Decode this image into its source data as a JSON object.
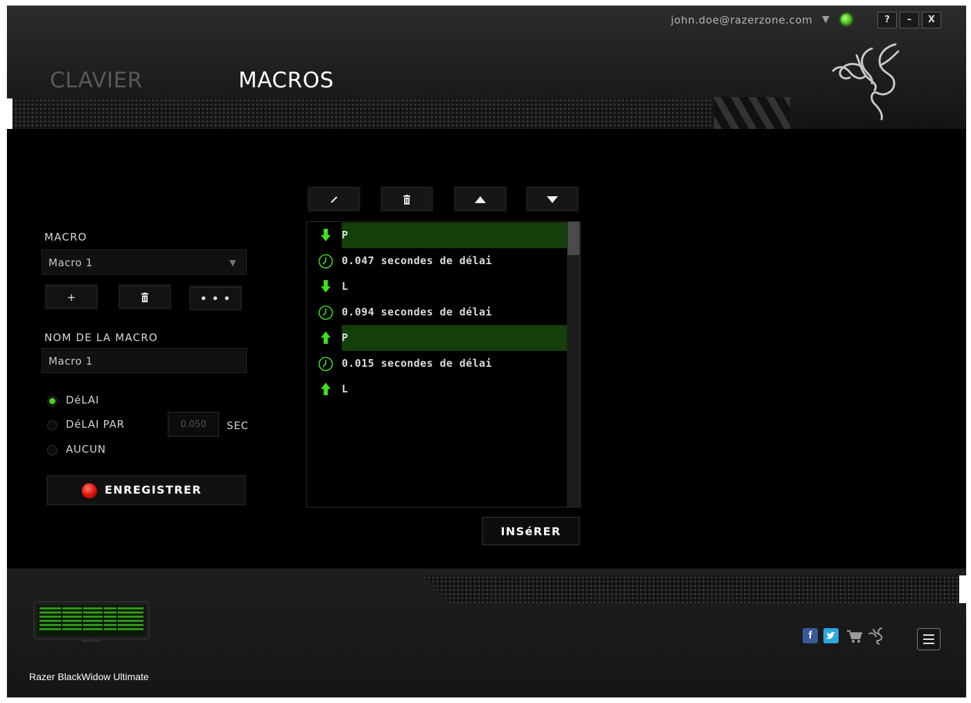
{
  "window": {
    "account_email": "john.doe@razerzone.com",
    "buttons": {
      "help": "?",
      "minimize": "–",
      "close": "X"
    }
  },
  "tabs": [
    {
      "label": "CLAVIER",
      "active": false
    },
    {
      "label": "MACROS",
      "active": true
    }
  ],
  "left_panel": {
    "macro_label": "MACRO",
    "macro_select_value": "Macro 1",
    "add_label": "+",
    "more_label": "• • •",
    "name_label": "NOM DE LA MACRO",
    "name_value": "Macro 1",
    "delay_options": [
      {
        "label": "DéLAI",
        "selected": true
      },
      {
        "label": "DéLAI PAR",
        "selected": false
      },
      {
        "label": "AUCUN",
        "selected": false
      }
    ],
    "delay_value": "0.050",
    "delay_unit": "SEC",
    "record_label": "ENREGISTRER"
  },
  "toolbar": {
    "icons": [
      "edit-icon",
      "trash-icon",
      "move-up-icon",
      "move-down-icon"
    ]
  },
  "macro_list": {
    "rows": [
      {
        "kind": "key-down",
        "text": "P",
        "selected": true
      },
      {
        "kind": "delay",
        "text": "0.047 secondes de délai",
        "selected": false
      },
      {
        "kind": "key-down",
        "text": "L",
        "selected": false
      },
      {
        "kind": "delay",
        "text": "0.094 secondes de délai",
        "selected": false
      },
      {
        "kind": "key-up",
        "text": "P",
        "selected": true
      },
      {
        "kind": "delay",
        "text": "0.015 secondes de délai",
        "selected": false
      },
      {
        "kind": "key-up",
        "text": "L",
        "selected": false
      }
    ],
    "insert_label": "INSéRER"
  },
  "footer": {
    "device_name": "Razer BlackWidow Ultimate",
    "social": {
      "facebook": "f"
    }
  },
  "colors": {
    "accent_green": "#44d11a",
    "selected_row": "#153f0a",
    "record_red": "#e0130a"
  }
}
